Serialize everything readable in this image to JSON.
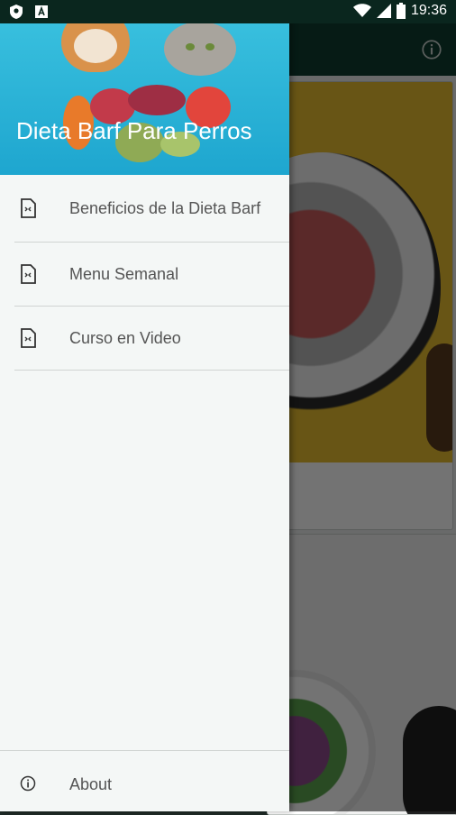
{
  "status_bar": {
    "time": "19:36",
    "left_icons": [
      "shield-icon",
      "a-box-icon"
    ],
    "right_icons": [
      "wifi-icon",
      "signal-icon",
      "battery-icon"
    ]
  },
  "drawer": {
    "header_title": "Dieta Barf Para Perros",
    "items": [
      {
        "label": "Beneficios de la Dieta Barf",
        "icon": "document-icon"
      },
      {
        "label": "Menu Semanal",
        "icon": "document-icon"
      },
      {
        "label": "Curso en Video",
        "icon": "document-icon"
      }
    ],
    "footer": {
      "label": "About",
      "icon": "info-icon"
    }
  },
  "toolbar": {
    "action_icon": "info-icon"
  },
  "colors": {
    "primary_dark": "#0a261e",
    "toolbar": "#0f3d30",
    "drawer_header": "#1ea6cf",
    "drawer_bg": "#f4f7f6",
    "text": "#555555"
  }
}
